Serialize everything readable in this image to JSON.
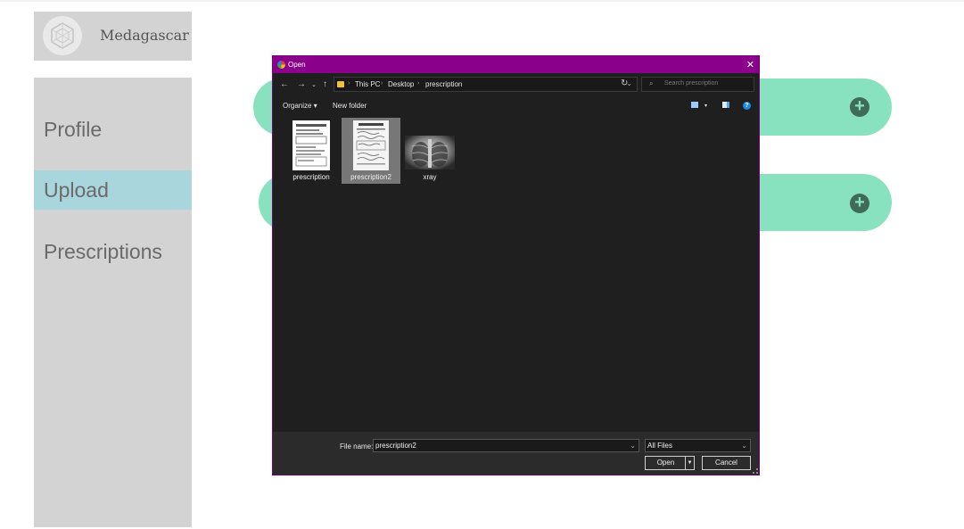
{
  "brand": {
    "name": "Medagascar",
    "logo_icon": "hexagon-cube-logo"
  },
  "sidebar": {
    "items": [
      {
        "label": "Profile",
        "active": false
      },
      {
        "label": "Upload",
        "active": true
      },
      {
        "label": "Prescriptions",
        "active": false
      }
    ]
  },
  "colors": {
    "accent_pill": "#88e2c0",
    "active_nav": "#a9d6dd",
    "dialog_titlebar": "#8b008b",
    "sidebar_bg": "#d3d3d3"
  },
  "upload": {
    "add_icon": "plus-circle-icon"
  },
  "dialog": {
    "title": "Open",
    "address": {
      "segments": [
        "This PC",
        "Desktop",
        "prescription"
      ]
    },
    "search_placeholder": "Search prescription",
    "toolbar": {
      "organize": "Organize ▾",
      "new_folder": "New folder"
    },
    "files": [
      {
        "name": "prescription",
        "selected": false,
        "type": "document"
      },
      {
        "name": "prescription2",
        "selected": true,
        "type": "document"
      },
      {
        "name": "xray",
        "selected": false,
        "type": "xray-image"
      }
    ],
    "file_name_label": "File name:",
    "file_name_value": "prescription2",
    "file_type": "All Files",
    "open_label": "Open",
    "cancel_label": "Cancel"
  }
}
